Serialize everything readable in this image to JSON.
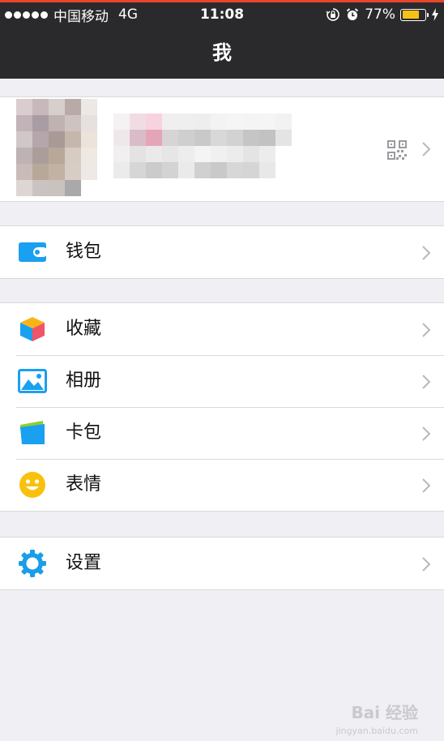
{
  "status_bar": {
    "carrier": "中国移动",
    "network": "4G",
    "time": "11:08",
    "battery": "77%",
    "battery_level": 0.77,
    "icons": [
      "signal-dots",
      "orientation-lock-icon",
      "alarm-icon",
      "battery-icon",
      "charging-bolt-icon"
    ]
  },
  "nav": {
    "title": "我"
  },
  "profile": {
    "avatar_blurred": true,
    "name_blurred": true,
    "icons": [
      "qr-code-icon",
      "chevron-right-icon"
    ]
  },
  "menu_groups": [
    {
      "items": [
        {
          "label": "钱包",
          "icon": "wallet-icon",
          "color": "#1aa0f0"
        }
      ]
    },
    {
      "items": [
        {
          "label": "收藏",
          "icon": "favorites-cube-icon",
          "color": "#f8b516"
        },
        {
          "label": "相册",
          "icon": "album-icon",
          "color": "#1aa0f0"
        },
        {
          "label": "卡包",
          "icon": "card-wallet-icon",
          "color": "#1aa0f0"
        },
        {
          "label": "表情",
          "icon": "emoji-icon",
          "color": "#f8c10c"
        }
      ]
    },
    {
      "items": [
        {
          "label": "设置",
          "icon": "settings-gear-icon",
          "color": "#1a9ee8"
        }
      ]
    }
  ],
  "watermark": {
    "text": "Bai 经验",
    "sub": "jingyan.baidu.com"
  },
  "colors": {
    "status_bar_bg": "#2a2a2c",
    "page_bg": "#efeff4",
    "accent_top_line": "#e8452b"
  }
}
